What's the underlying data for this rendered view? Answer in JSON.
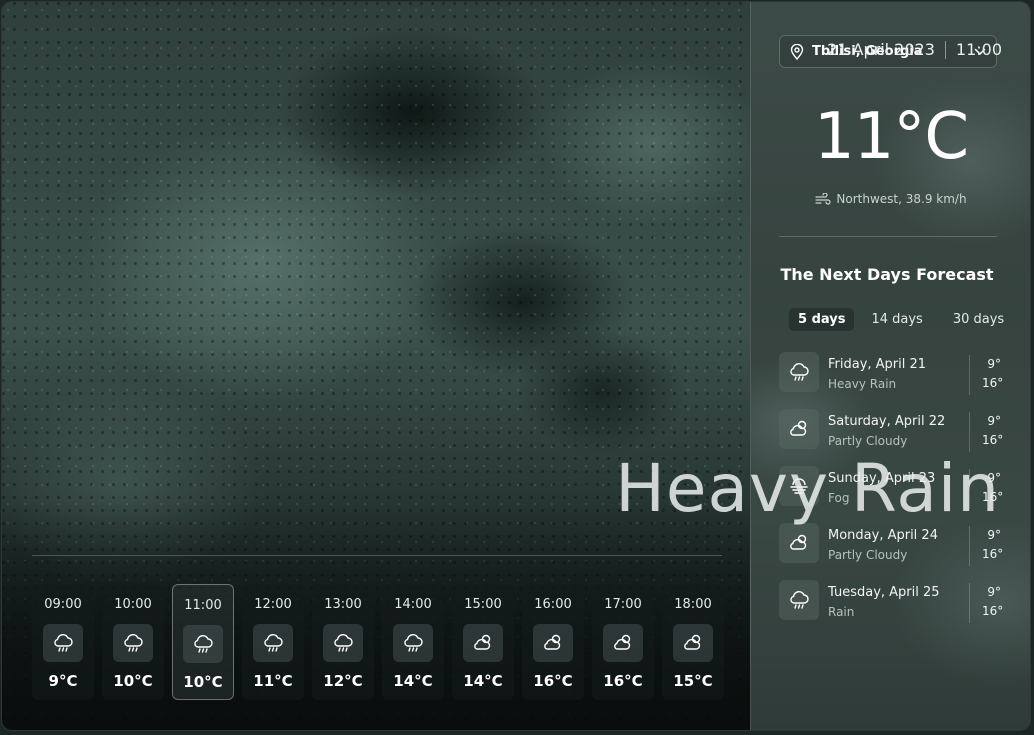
{
  "header": {
    "date": "21 April 2023",
    "time": "11:00"
  },
  "current": {
    "condition": "Heavy Rain",
    "temperature": "11°C",
    "wind": "Northwest, 38.9 km/h",
    "location": "Tbilisi, Georgia"
  },
  "hourly": [
    {
      "time": "09:00",
      "temp": "9°C",
      "icon": "rain-cloud-icon"
    },
    {
      "time": "10:00",
      "temp": "10°C",
      "icon": "rain-cloud-icon"
    },
    {
      "time": "11:00",
      "temp": "10°C",
      "icon": "rain-cloud-icon",
      "active": true
    },
    {
      "time": "12:00",
      "temp": "11°C",
      "icon": "rain-cloud-icon"
    },
    {
      "time": "13:00",
      "temp": "12°C",
      "icon": "rain-cloud-icon"
    },
    {
      "time": "14:00",
      "temp": "14°C",
      "icon": "rain-cloud-icon"
    },
    {
      "time": "15:00",
      "temp": "14°C",
      "icon": "partly-cloudy-icon"
    },
    {
      "time": "16:00",
      "temp": "16°C",
      "icon": "partly-cloudy-icon"
    },
    {
      "time": "17:00",
      "temp": "16°C",
      "icon": "partly-cloudy-icon"
    },
    {
      "time": "18:00",
      "temp": "15°C",
      "icon": "partly-cloudy-icon"
    }
  ],
  "forecast": {
    "title": "The Next Days Forecast",
    "tabs": [
      "5 days",
      "14 days",
      "30 days"
    ],
    "active_tab": "5 days",
    "days": [
      {
        "date": "Friday, April 21",
        "condition": "Heavy Rain",
        "low": "9°",
        "high": "16°",
        "icon": "rain-cloud-icon"
      },
      {
        "date": "Saturday, April 22",
        "condition": "Partly Cloudy",
        "low": "9°",
        "high": "16°",
        "icon": "partly-cloudy-icon"
      },
      {
        "date": "Sunday, April 23",
        "condition": "Fog",
        "low": "9°",
        "high": "16°",
        "icon": "fog-icon"
      },
      {
        "date": "Monday, April 24",
        "condition": "Partly Cloudy",
        "low": "9°",
        "high": "16°",
        "icon": "partly-cloudy-icon"
      },
      {
        "date": "Tuesday, April 25",
        "condition": "Rain",
        "low": "9°",
        "high": "16°",
        "icon": "rain-cloud-icon"
      }
    ]
  }
}
